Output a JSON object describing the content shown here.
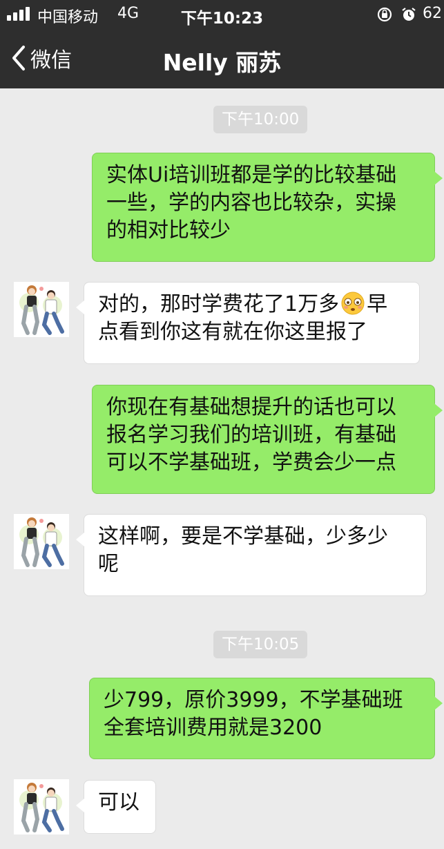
{
  "status_bar": {
    "carrier": "中国移动",
    "network": "4G",
    "time": "下午10:23",
    "battery": "62"
  },
  "nav": {
    "back_label": "微信",
    "title": "Nelly 丽苏"
  },
  "messages": [
    {
      "type": "time",
      "text": "下午10:00"
    },
    {
      "type": "sent",
      "lines": [
        "实体Ui培训班都是学的比较基础",
        "一些，学的内容也比较杂，实操",
        "的相对比较少"
      ]
    },
    {
      "type": "received",
      "line1_before_emoji": "对的，那时学费花了1万多",
      "emoji": "flushed-face-emoji",
      "line1_after_emoji": "早",
      "line2": "点看到你这有就在你这里报了"
    },
    {
      "type": "sent",
      "lines": [
        "你现在有基础想提升的话也可以",
        "报名学习我们的培训班，有基础",
        "可以不学基础班，学费会少一点"
      ]
    },
    {
      "type": "received",
      "lines": [
        "这样啊，要是不学基础，少多少",
        "呢"
      ]
    },
    {
      "type": "time",
      "text": "下午10:05"
    },
    {
      "type": "sent",
      "lines": [
        "少799，原价3999，不学基础班",
        "全套培训费用就是3200"
      ]
    },
    {
      "type": "received",
      "lines": [
        "可以"
      ]
    }
  ],
  "colors": {
    "nav_background": "#2e2e2e",
    "chat_background": "#ebebeb",
    "sent_bubble": "#95ec69",
    "received_bubble": "#ffffff",
    "time_badge": "#d9d9d9"
  },
  "icons": [
    "signal-icon",
    "rotation-lock-icon",
    "alarm-icon",
    "back-chevron-icon",
    "contact-avatar"
  ]
}
